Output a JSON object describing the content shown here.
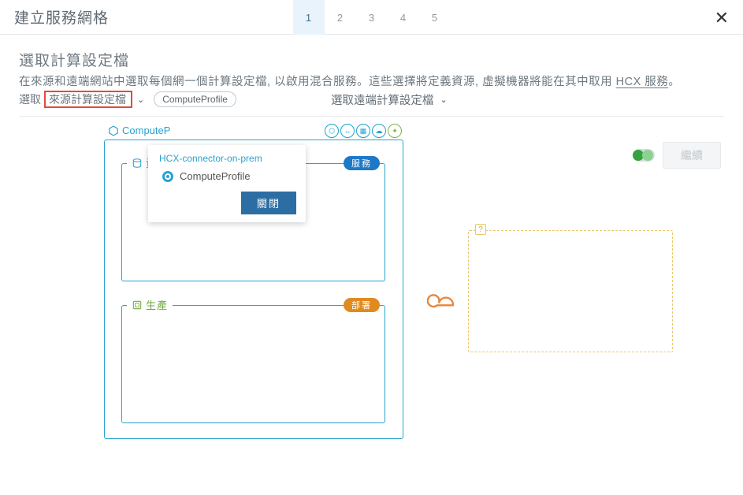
{
  "header": {
    "title": "建立服務網格",
    "steps": [
      "1",
      "2",
      "3",
      "4",
      "5"
    ],
    "activeStep": 0
  },
  "section": {
    "title": "選取計算設定檔",
    "desc_pre": "在來源和遠端網站中選取每個網一個計算設定檔, 以啟用混合服務。這些選擇將定義資源, 虛擬機器將能在其中取用 ",
    "desc_link": "HCX 服務",
    "desc_post": "。"
  },
  "selectorLeft": {
    "label": "選取",
    "highlight": "來源計算設定檔",
    "pill": "ComputeProfile"
  },
  "selectorRight": {
    "label": "選取遠端計算設定檔"
  },
  "buttons": {
    "continue": "繼續"
  },
  "popup": {
    "header": "HCX-connector-on-prem",
    "option": "ComputeProfile",
    "close": "關閉"
  },
  "diagram": {
    "computeLabel": "ComputeP",
    "box1": {
      "label": "資料",
      "tag": "服務"
    },
    "box2": {
      "label": "生產",
      "tag": "部署"
    }
  },
  "icons": {
    "hex": "hex-icon",
    "cloud": "cloud-icon"
  }
}
